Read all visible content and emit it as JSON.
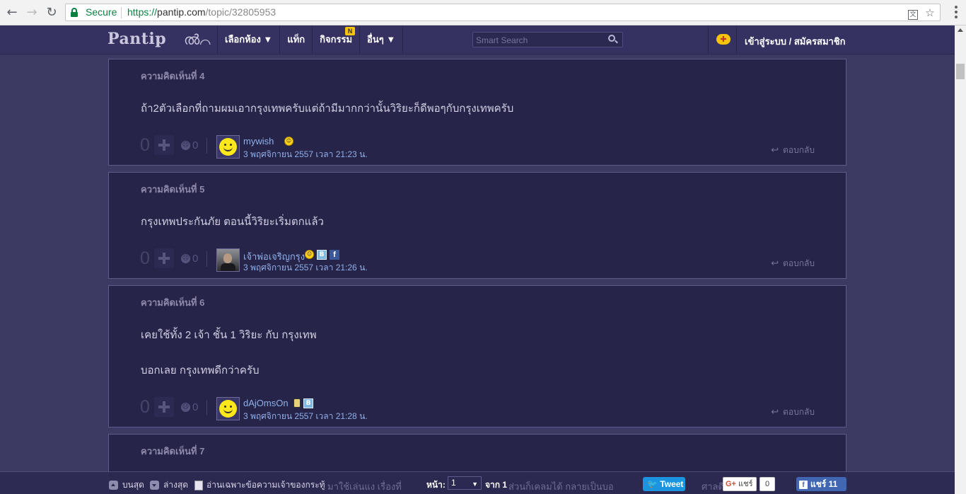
{
  "browser": {
    "secure_label": "Secure",
    "url_scheme": "https://",
    "url_host": "pantip.com",
    "url_path": "/topic/32805953"
  },
  "header": {
    "logo": "Pantip",
    "logo_mark": "ൽ⌒",
    "nav": [
      {
        "label": "เลือกห้อง ▼"
      },
      {
        "label": "แท็ก"
      },
      {
        "label": "กิจกรรม",
        "badge": "N"
      },
      {
        "label": "อื่นๆ ▼"
      }
    ],
    "search_placeholder": "Smart Search",
    "login_label": "เข้าสู่ระบบ / สมัครสมาชิก"
  },
  "comments": [
    {
      "title": "ความคิดเห็นที่ 4",
      "lines": [
        "ถ้า2ตัวเลือกที่ถามผมเอากรุงเทพครับแต่ถ้ามีมากกว่านั้นวิริยะก็ดีพอๆกับกรุงเทพครับ"
      ],
      "votes": "0",
      "emotions": "0",
      "author": "mywish",
      "timestamp": "3 พฤศจิกายน 2557 เวลา 21:23 น.",
      "reply": "ตอบกลับ"
    },
    {
      "title": "ความคิดเห็นที่ 5",
      "lines": [
        "กรุงเทพประกันภัย ตอนนี้วิริยะเริ่มตกแล้ว"
      ],
      "votes": "0",
      "emotions": "0",
      "author": "เจ้าพ่อเจริญกรุง",
      "timestamp": "3 พฤศจิกายน 2557 เวลา 21:26 น.",
      "reply": "ตอบกลับ"
    },
    {
      "title": "ความคิดเห็นที่ 6",
      "lines": [
        "เคยใช้ทั้ง 2 เจ้า ชั้น 1 วิริยะ กับ กรุงเทพ",
        "บอกเลย กรุงเทพดีกว่าครับ"
      ],
      "votes": "0",
      "emotions": "0",
      "author": "dAjOmsOn",
      "timestamp": "3 พฤศจิกายน 2557 เวลา 21:28 น.",
      "reply": "ตอบกลับ"
    },
    {
      "title": "ความคิดเห็นที่ 7"
    }
  ],
  "bottom_bar": {
    "top_label": "บนสุด",
    "bottom_label": "ล่างสุด",
    "owner_only_label": "อ่านเฉพาะข้อความเจ้าของกระทู้",
    "page_label": "หน้า:",
    "page_value": "1",
    "page_of": "จาก 1",
    "tweet": "Tweet",
    "gplus": "แชร์",
    "gplus_count": "0",
    "fb_share": "แชร์ 11",
    "ghost_text_1": "มาใช้เล่นแง เรื่องที่",
    "ghost_text_2": "ส่วนก็เคลมได้ กลายเป็นบอ",
    "ghost_text_3": "ศาลดี"
  }
}
